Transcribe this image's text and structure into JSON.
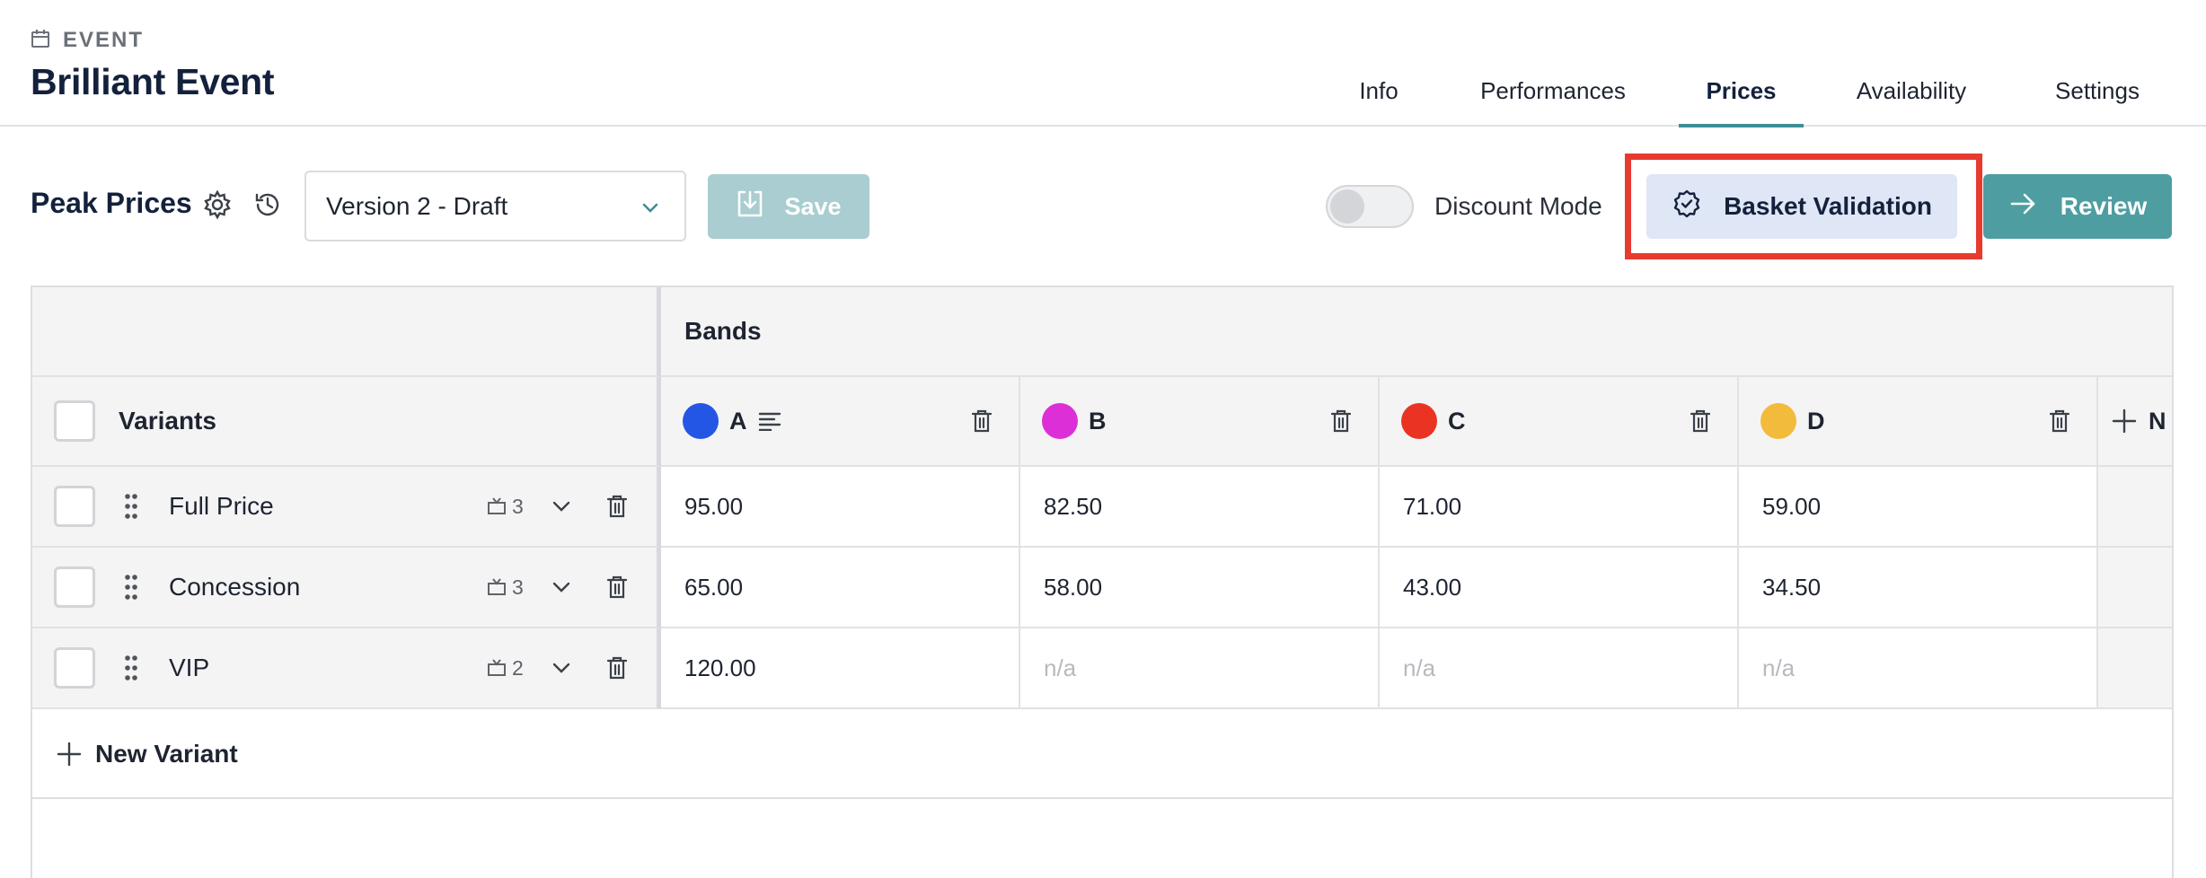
{
  "header": {
    "eyebrow": "EVENT",
    "title": "Brilliant Event",
    "tabs": [
      {
        "label": "Info",
        "active": false
      },
      {
        "label": "Performances",
        "active": false
      },
      {
        "label": "Prices",
        "active": true
      },
      {
        "label": "Availability",
        "active": false
      },
      {
        "label": "Settings",
        "active": false
      }
    ]
  },
  "toolbar": {
    "title": "Peak Prices",
    "version_selected": "Version 2 - Draft",
    "save_label": "Save",
    "discount_mode_label": "Discount Mode",
    "discount_mode_on": false,
    "basket_validation_label": "Basket Validation",
    "review_label": "Review"
  },
  "grid": {
    "bands_header": "Bands",
    "variants_header": "Variants",
    "new_band_label": "N",
    "bands": [
      {
        "name": "A",
        "color": "#2356e4",
        "has_notes": true
      },
      {
        "name": "B",
        "color": "#dd2fd8",
        "has_notes": false
      },
      {
        "name": "C",
        "color": "#ea3323",
        "has_notes": false
      },
      {
        "name": "D",
        "color": "#f3bb3b",
        "has_notes": false
      }
    ],
    "variants": [
      {
        "name": "Full Price",
        "performances": "3",
        "prices": [
          "95.00",
          "82.50",
          "71.00",
          "59.00"
        ]
      },
      {
        "name": "Concession",
        "performances": "3",
        "prices": [
          "65.00",
          "58.00",
          "43.00",
          "34.50"
        ]
      },
      {
        "name": "VIP",
        "performances": "2",
        "prices": [
          "120.00",
          "n/a",
          "n/a",
          "n/a"
        ]
      }
    ],
    "new_variant_label": "New Variant"
  },
  "colors": {
    "accent": "#3f8f95",
    "save_disabled": "#a9cdd0",
    "review_button": "#4e9ea1",
    "basket_button": "#dfe6f5",
    "highlight": "#e63b2e"
  }
}
